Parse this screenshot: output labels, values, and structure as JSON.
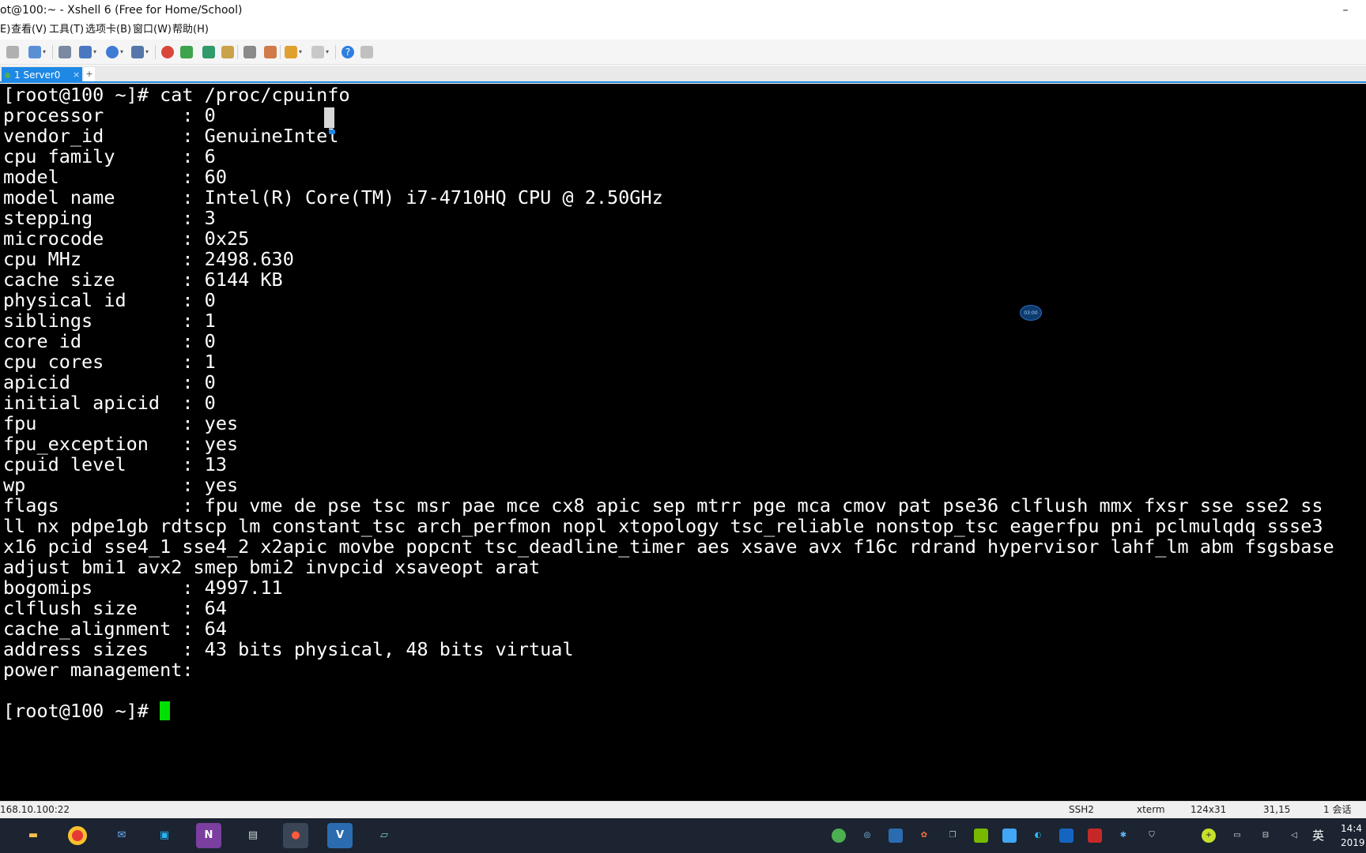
{
  "window": {
    "title": "ot@100:~ - Xshell 6 (Free for Home/School)",
    "minimize_glyph": "–"
  },
  "menu": {
    "items": [
      "E)",
      "查看(V)",
      "工具(T)",
      "选项卡(B)",
      "窗口(W)",
      "帮助(H)"
    ]
  },
  "toolbar": {
    "icons": [
      "link-icon",
      "new-session-icon",
      "search-icon",
      "transfer-icon",
      "globe-icon",
      "font-icon",
      "xftp-icon",
      "xmanager-icon",
      "fullscreen-icon",
      "lock-icon",
      "keyboard-icon",
      "script-icon",
      "compose-icon",
      "layout-icon",
      "help-icon",
      "chat-icon"
    ],
    "help_glyph": "?"
  },
  "tabs": {
    "active_label": "1 Server0",
    "close_glyph": "×",
    "add_glyph": "+"
  },
  "terminal": {
    "lines": [
      "[root@100 ~]# cat /proc/cpuinfo",
      "processor       : 0",
      "vendor_id       : GenuineIntel",
      "cpu family      : 6",
      "model           : 60",
      "model name      : Intel(R) Core(TM) i7-4710HQ CPU @ 2.50GHz",
      "stepping        : 3",
      "microcode       : 0x25",
      "cpu MHz         : 2498.630",
      "cache size      : 6144 KB",
      "physical id     : 0",
      "siblings        : 1",
      "core id         : 0",
      "cpu cores       : 1",
      "apicid          : 0",
      "initial apicid  : 0",
      "fpu             : yes",
      "fpu_exception   : yes",
      "cpuid level     : 13",
      "wp              : yes",
      "flags           : fpu vme de pse tsc msr pae mce cx8 apic sep mtrr pge mca cmov pat pse36 clflush mmx fxsr sse sse2 ss",
      "ll nx pdpe1gb rdtscp lm constant_tsc arch_perfmon nopl xtopology tsc_reliable nonstop_tsc eagerfpu pni pclmulqdq ssse3",
      "x16 pcid sse4_1 sse4_2 x2apic movbe popcnt tsc_deadline_timer aes xsave avx f16c rdrand hypervisor lahf_lm abm fsgsbase",
      "adjust bmi1 avx2 smep bmi2 invpcid xsaveopt arat",
      "bogomips        : 4997.11",
      "clflush size    : 64",
      "cache_alignment : 64",
      "address sizes   : 43 bits physical, 48 bits virtual",
      "power management:",
      "",
      "[root@100 ~]# "
    ],
    "overlay_text": "03:00"
  },
  "status": {
    "address": "168.10.100:22",
    "protocol": "SSH2",
    "terminal_type": "xterm",
    "size": "124x31",
    "position": "31,15",
    "sessions": "1 会话"
  },
  "taskbar": {
    "apps": [
      "file-explorer-icon",
      "chrome-icon",
      "mail-icon",
      "code-icon",
      "onenote-icon",
      "computer-icon",
      "xshell-icon",
      "vnc-icon",
      "notepad-icon"
    ],
    "tray": [
      "security-icon",
      "vmware-icon",
      "vnc-tray-icon",
      "xshell-tray-icon",
      "copy-icon",
      "nvidia-icon",
      "display-icon",
      "edge-icon",
      "sb-icon",
      "tools-icon",
      "bluetooth-icon",
      "shield-icon",
      "plus-icon",
      "battery-icon",
      "network-icon",
      "volume-icon"
    ],
    "ime": "英",
    "clock_time": "14:4",
    "clock_date": "2019"
  },
  "colors": {
    "terminal_bg": "#000000",
    "terminal_fg": "#ffffff",
    "cursor": "#00e000",
    "tab_active": "#1e88e5",
    "taskbar_bg": "#1b2430"
  }
}
